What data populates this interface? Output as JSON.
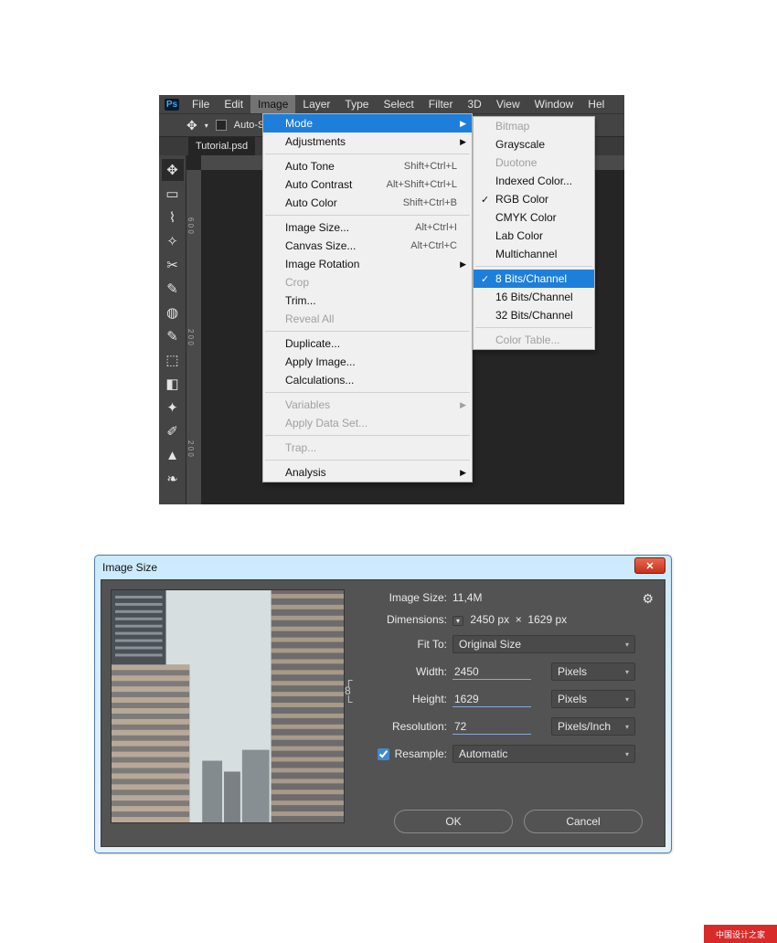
{
  "menubar": {
    "items": [
      "File",
      "Edit",
      "Image",
      "Layer",
      "Type",
      "Select",
      "Filter",
      "3D",
      "View",
      "Window",
      "Hel"
    ],
    "selected_index": 2,
    "logo": "Ps"
  },
  "toolbar": {
    "auto_select_label": "Auto-S"
  },
  "tab": {
    "filename": "Tutorial.psd"
  },
  "ruler": {
    "v_marks": [
      "6 0 0",
      "2 0 0",
      "2 0 0"
    ]
  },
  "ps_tools": {
    "items": [
      {
        "name": "move-tool-icon",
        "glyph": "✥",
        "active": true
      },
      {
        "name": "marquee-tool-icon",
        "glyph": "▭"
      },
      {
        "name": "lasso-tool-icon",
        "glyph": "⌇"
      },
      {
        "name": "magic-wand-tool-icon",
        "glyph": "✧"
      },
      {
        "name": "crop-tool-icon",
        "glyph": "✂"
      },
      {
        "name": "eyedropper-tool-icon",
        "glyph": "✎"
      },
      {
        "name": "healing-brush-tool-icon",
        "glyph": "◍"
      },
      {
        "name": "brush-tool-icon",
        "glyph": "✎"
      },
      {
        "name": "stamp-tool-icon",
        "glyph": "⬚"
      },
      {
        "name": "eraser-tool-icon",
        "glyph": "◧"
      },
      {
        "name": "paint-bucket-tool-icon",
        "glyph": "✦"
      },
      {
        "name": "pen-tool-icon",
        "glyph": "✐"
      },
      {
        "name": "clone-tool-icon",
        "glyph": "▲"
      },
      {
        "name": "history-brush-tool-icon",
        "glyph": "❧"
      }
    ]
  },
  "image_menu": {
    "groups": [
      [
        {
          "label": "Mode",
          "arrow": true,
          "highlight": true
        },
        {
          "label": "Adjustments",
          "arrow": true
        }
      ],
      [
        {
          "label": "Auto Tone",
          "shortcut": "Shift+Ctrl+L"
        },
        {
          "label": "Auto Contrast",
          "shortcut": "Alt+Shift+Ctrl+L"
        },
        {
          "label": "Auto Color",
          "shortcut": "Shift+Ctrl+B"
        }
      ],
      [
        {
          "label": "Image Size...",
          "shortcut": "Alt+Ctrl+I"
        },
        {
          "label": "Canvas Size...",
          "shortcut": "Alt+Ctrl+C"
        },
        {
          "label": "Image Rotation",
          "arrow": true
        },
        {
          "label": "Crop",
          "disabled": true
        },
        {
          "label": "Trim..."
        },
        {
          "label": "Reveal All",
          "disabled": true
        }
      ],
      [
        {
          "label": "Duplicate..."
        },
        {
          "label": "Apply Image..."
        },
        {
          "label": "Calculations..."
        }
      ],
      [
        {
          "label": "Variables",
          "arrow": true,
          "disabled": true
        },
        {
          "label": "Apply Data Set...",
          "disabled": true
        }
      ],
      [
        {
          "label": "Trap...",
          "disabled": true
        }
      ],
      [
        {
          "label": "Analysis",
          "arrow": true
        }
      ]
    ]
  },
  "mode_menu": {
    "groups": [
      [
        {
          "label": "Bitmap",
          "disabled": true
        },
        {
          "label": "Grayscale"
        },
        {
          "label": "Duotone",
          "disabled": true
        },
        {
          "label": "Indexed Color..."
        },
        {
          "label": "RGB Color",
          "checked": true
        },
        {
          "label": "CMYK Color"
        },
        {
          "label": "Lab Color"
        },
        {
          "label": "Multichannel"
        }
      ],
      [
        {
          "label": "8 Bits/Channel",
          "checked": true,
          "highlight": true
        },
        {
          "label": "16 Bits/Channel"
        },
        {
          "label": "32 Bits/Channel"
        }
      ],
      [
        {
          "label": "Color Table...",
          "disabled": true
        }
      ]
    ]
  },
  "dialog": {
    "title": "Image Size",
    "labels": {
      "image_size": "Image Size:",
      "dimensions": "Dimensions:",
      "fit_to": "Fit To:",
      "width": "Width:",
      "height": "Height:",
      "resolution": "Resolution:",
      "resample": "Resample:"
    },
    "values": {
      "image_size": "11,4M",
      "dim_w": "2450 px",
      "dim_h": "1629 px",
      "dim_sep": "×",
      "fit_to": "Original Size",
      "width": "2450",
      "height": "1629",
      "resolution": "72",
      "unit_wh": "Pixels",
      "unit_res": "Pixels/Inch",
      "resample": "Automatic"
    },
    "buttons": {
      "ok": "OK",
      "cancel": "Cancel"
    },
    "close_glyph": "✕"
  },
  "watermark": "中国设计之家"
}
